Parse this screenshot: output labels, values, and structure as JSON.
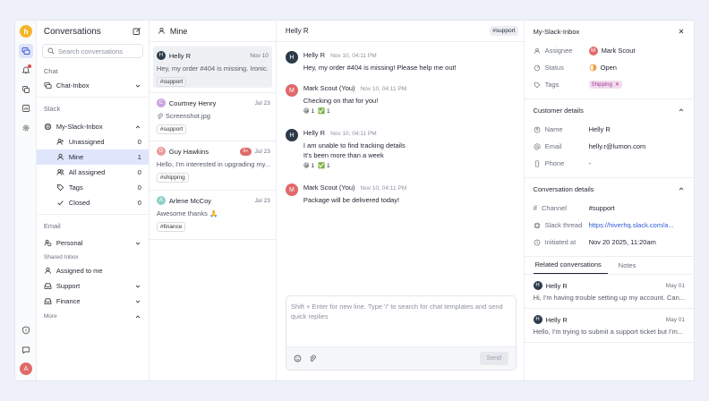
{
  "rail": {
    "logo": "h",
    "avatar": "A"
  },
  "sidebar": {
    "title": "Conversations",
    "search_placeholder": "Search conversations",
    "chat_section": "Chat",
    "chat_inbox": "Chat-Inbox",
    "slack_section": "Slack",
    "slack_inbox": "My-Slack-Inbox",
    "slack_items": [
      {
        "label": "Unassigned",
        "count": "0"
      },
      {
        "label": "Mine",
        "count": "1"
      },
      {
        "label": "All assigned",
        "count": "0"
      },
      {
        "label": "Tags",
        "count": "0"
      },
      {
        "label": "Closed",
        "count": "0"
      }
    ],
    "email_section": "Email",
    "personal": "Personal",
    "shared_inbox": "Shared Inbox",
    "assigned_to_me": "Assigned to me",
    "support": "Support",
    "finance": "Finance",
    "more": "More"
  },
  "list": {
    "title": "Mine",
    "items": [
      {
        "name": "Helly R",
        "date": "Nov 10",
        "preview": "Hey, my order #404 is missing. Ironic...",
        "tag": "#support",
        "initial": "H",
        "color": "#2c3a4a"
      },
      {
        "name": "Courtney Henry",
        "date": "Jul 23",
        "preview": "Screenshot.jpg",
        "tag": "#support",
        "initial": "C",
        "color": "#c9a3e0"
      },
      {
        "name": "Guy Hawkins",
        "date": "Jul 23",
        "preview": "Hello, I'm interested in upgrading my...",
        "tag": "#shipping",
        "initial": "G",
        "color": "#e89a9a",
        "badge": "9+"
      },
      {
        "name": "Arlene McCoy",
        "date": "Jul 23",
        "preview": "Awesome thanks 🙏",
        "tag": "#finance",
        "initial": "A",
        "color": "#8fd0c8"
      }
    ]
  },
  "chat": {
    "title": "Helly R",
    "channel": "#support",
    "messages": [
      {
        "name": "Helly R",
        "time": "Nov 10, 04:11 PM",
        "text": [
          "Hey, my order #404 is missing! Please help me out!"
        ],
        "initial": "H",
        "color": "#2c3a4a"
      },
      {
        "name": "Mark Scout (You)",
        "time": "Nov 10, 04:11 PM",
        "text": [
          "Checking on that for you!"
        ],
        "initial": "M",
        "color": "#e06a6a",
        "reacts": [
          "😀 1",
          "✅ 1"
        ]
      },
      {
        "name": "Helly R",
        "time": "Nov 10, 04:11 PM",
        "text": [
          "I am unable to find tracking details",
          "It's been more than a week"
        ],
        "initial": "H",
        "color": "#2c3a4a",
        "reacts": [
          "😀 1",
          "✅ 1"
        ]
      },
      {
        "name": "Mark Scout (You)",
        "time": "Nov 10, 04:11 PM",
        "text": [
          "Package will be delivered today!"
        ],
        "initial": "M",
        "color": "#e06a6a"
      }
    ],
    "composer_placeholder": "Shift + Enter for new line. Type '/' to search for chat templates and send quick replies",
    "send_label": "Send"
  },
  "details": {
    "title": "My-Slack-Inbox",
    "assignee_label": "Assignee",
    "assignee_value": "Mark Scout",
    "status_label": "Status",
    "status_value": "Open",
    "tags_label": "Tags",
    "tag_value": "Shipping",
    "customer_section": "Customer details",
    "name_label": "Name",
    "name_value": "Helly R",
    "email_label": "Email",
    "email_value": "helly.r@lumon.com",
    "phone_label": "Phone",
    "phone_value": "-",
    "conversation_section": "Conversation details",
    "channel_label": "Channel",
    "channel_value": "#support",
    "thread_label": "Slack thread",
    "thread_value": "https://hiverhq.slack.com/a...",
    "initiated_label": "Initiated at",
    "initiated_value": "Nov 20 2025, 11:20am",
    "tab_related": "Related conversations",
    "tab_notes": "Notes",
    "related": [
      {
        "name": "Helly R",
        "date": "May 01",
        "preview": "Hi, I'm having trouble setting up my account. Can..."
      },
      {
        "name": "Helly R",
        "date": "May 01",
        "preview": "Hello, I'm trying to submit a support ticket but I'm..."
      }
    ]
  }
}
